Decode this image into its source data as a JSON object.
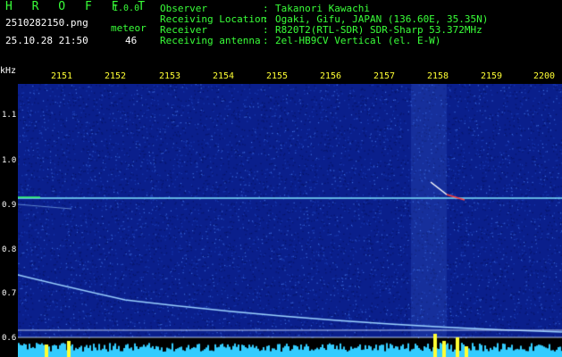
{
  "app": {
    "brand": "H R O F F T",
    "version": "1.0.0",
    "filename": "2510282150.png",
    "datetime": "25.10.28 21:50",
    "meteor_label": "meteor",
    "meteor_count": "46"
  },
  "info": [
    {
      "key": "Observer",
      "sep": ":",
      "value": "Takanori Kawachi"
    },
    {
      "key": "Receiving Location",
      "sep": ":",
      "value": "Ogaki, Gifu, JAPAN (136.60E, 35.35N)"
    },
    {
      "key": "Receiver",
      "sep": ":",
      "value": "R820T2(RTL-SDR) SDR-Sharp 53.372MHz"
    },
    {
      "key": "Receiving antenna",
      "sep": ":",
      "value": "2el-HB9CV Vertical (el. E-W)"
    }
  ],
  "axis": {
    "y_unit": "kHz",
    "x_ticks": [
      "2151",
      "2152",
      "2153",
      "2154",
      "2155",
      "2156",
      "2157",
      "2158",
      "2159",
      "2200"
    ],
    "y_ticks": [
      "1.1",
      "1.0",
      "0.9",
      "0.8",
      "0.7",
      "0.6"
    ]
  },
  "colors": {
    "background": "#000000",
    "spectrum_base": "#0a1f8c",
    "noise_light": "#3f6fe0",
    "signal_carrier": "#7fe6ff",
    "meteor_trail": "#9ad0ff",
    "meteor_hot": "#ff4040",
    "histogram": "#33ccff",
    "histogram_peak": "#ffff33",
    "label_green": "#39ff39",
    "label_yellow": "#ffff33"
  }
}
